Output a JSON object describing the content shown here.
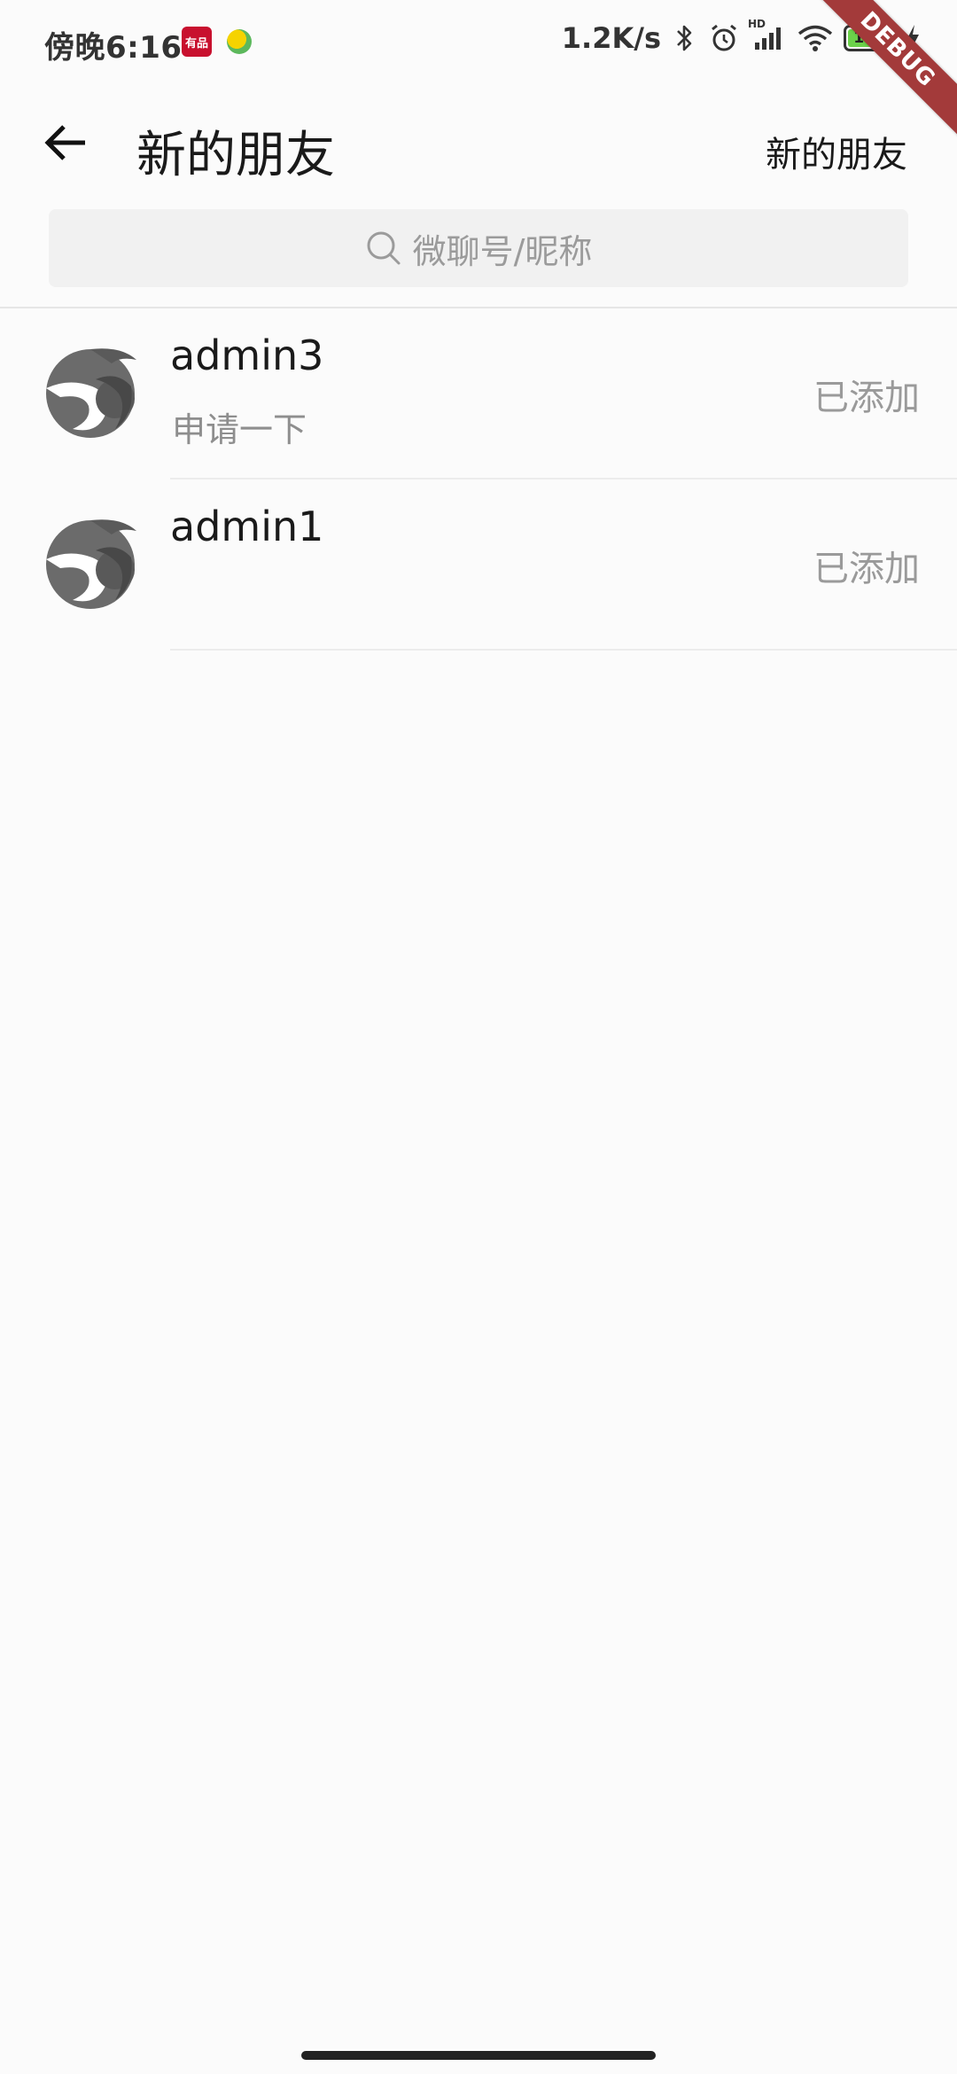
{
  "status_bar": {
    "time": "傍晚6:16",
    "app_badge_text": "有品",
    "network_speed": "1.2K/s",
    "network_label": "HD",
    "battery": "100"
  },
  "debug_banner": "DEBUG",
  "app_bar": {
    "title": "新的朋友",
    "action_label": "新的朋友"
  },
  "search": {
    "placeholder": "微聊号/昵称"
  },
  "friends": [
    {
      "name": "admin3",
      "message": "申请一下",
      "status": "已添加"
    },
    {
      "name": "admin1",
      "message": "",
      "status": "已添加"
    }
  ],
  "colors": {
    "accent_ribbon": "#a33a3a",
    "muted_text": "#9a9a9a",
    "search_bg": "#f1f1f1"
  }
}
